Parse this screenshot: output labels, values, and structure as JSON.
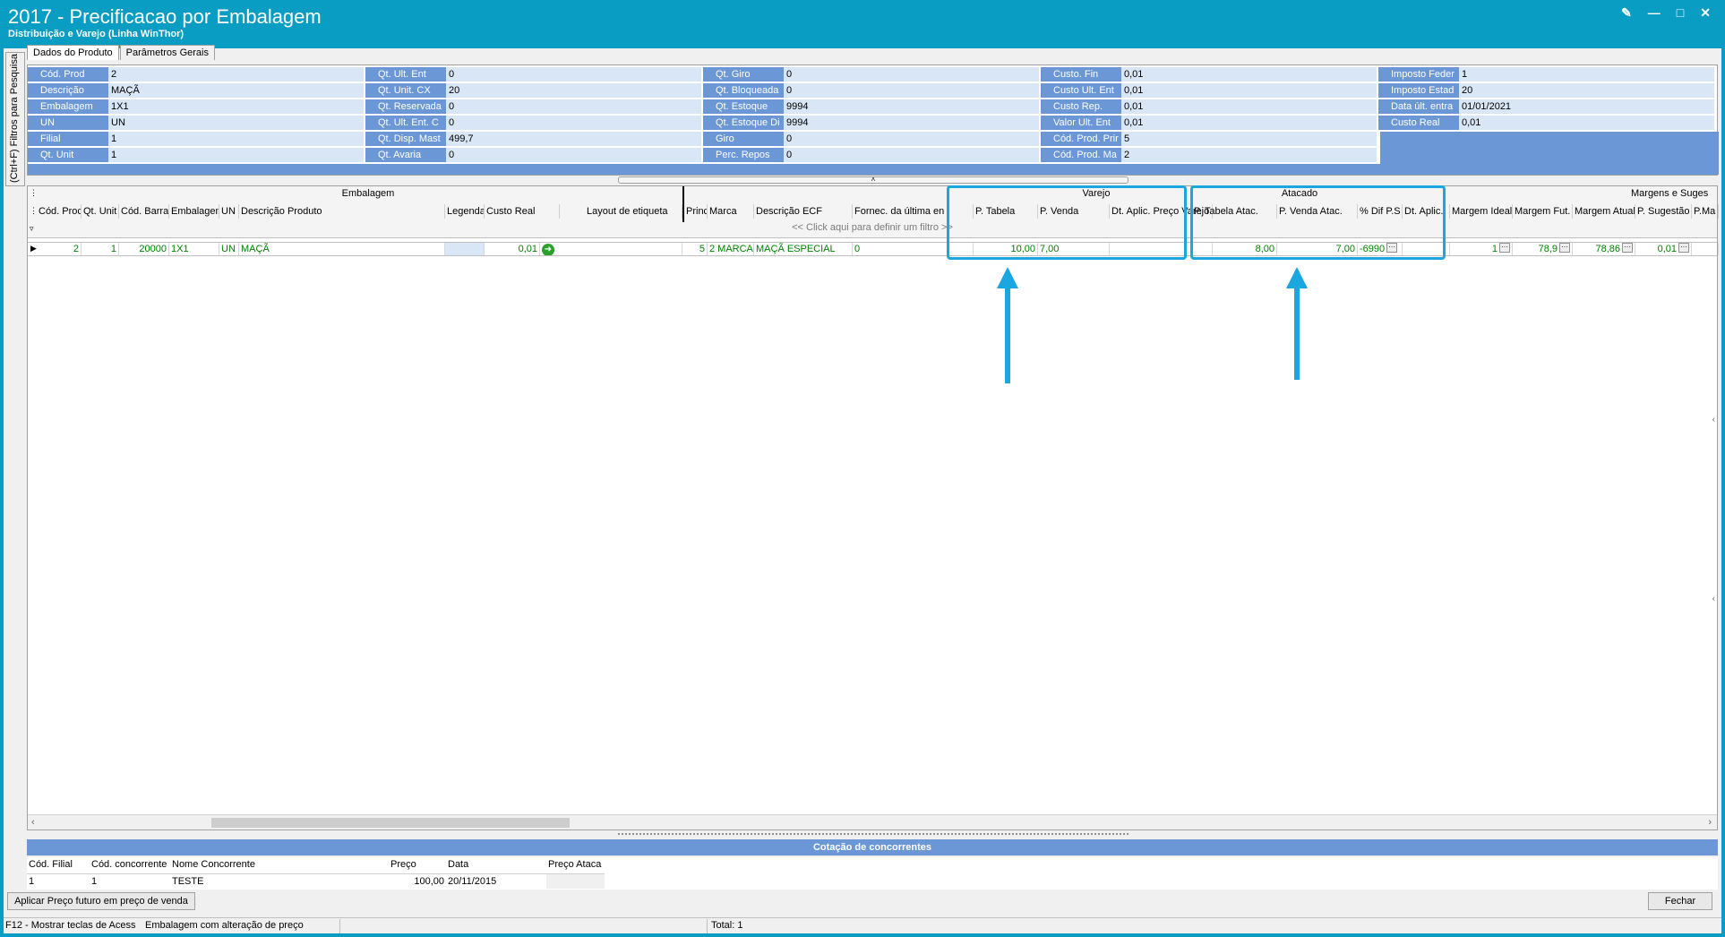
{
  "window": {
    "title": "2017 - Precificacao por Embalagem",
    "subtitle": "Distribuição e Varejo (Linha WinThor)"
  },
  "side_tab": "(Ctrl+F) Filtros para Pesquisa",
  "tabs": [
    "Dados do Produto",
    "Parâmetros Gerais"
  ],
  "info": {
    "col1": [
      {
        "label": "Cód. Prod",
        "value": "2"
      },
      {
        "label": "Descrição",
        "value": "MAÇÃ"
      },
      {
        "label": "Embalagem",
        "value": "1X1"
      },
      {
        "label": "UN",
        "value": "UN"
      },
      {
        "label": "Filial",
        "value": "1"
      },
      {
        "label": "Qt. Unit",
        "value": "1"
      }
    ],
    "col2": [
      {
        "label": "Qt. Ult. Ent",
        "value": "0"
      },
      {
        "label": "Qt. Unit. CX",
        "value": "20"
      },
      {
        "label": "Qt. Reservada",
        "value": "0"
      },
      {
        "label": "Qt. Ult. Ent. C",
        "value": "0"
      },
      {
        "label": "Qt. Disp. Mast",
        "value": "499,7"
      },
      {
        "label": "Qt. Avaria",
        "value": "0"
      }
    ],
    "col3": [
      {
        "label": "Qt. Giro",
        "value": "0"
      },
      {
        "label": "Qt. Bloqueada",
        "value": "0"
      },
      {
        "label": "Qt. Estoque",
        "value": "9994"
      },
      {
        "label": "Qt. Estoque Di",
        "value": "9994"
      },
      {
        "label": "Giro",
        "value": "0"
      },
      {
        "label": "Perc. Repos",
        "value": "0"
      }
    ],
    "col4": [
      {
        "label": "Custo. Fin",
        "value": "0,01"
      },
      {
        "label": "Custo Ult. Ent",
        "value": "0,01"
      },
      {
        "label": "Custo Rep.",
        "value": "0,01"
      },
      {
        "label": "Valor Ult. Ent",
        "value": "0,01"
      },
      {
        "label": "Cód. Prod. Prir",
        "value": "5"
      },
      {
        "label": "Cód. Prod. Ma",
        "value": "2"
      }
    ],
    "col5": [
      {
        "label": "Imposto Feder",
        "value": "1"
      },
      {
        "label": "Imposto Estad",
        "value": "20"
      },
      {
        "label": "Data últ. entra",
        "value": "01/01/2021"
      },
      {
        "label": "Custo Real",
        "value": "0,01"
      }
    ]
  },
  "grid": {
    "bands": {
      "embalagem": "Embalagem",
      "varejo": "Varejo",
      "atacado": "Atacado",
      "margens": "Margens e Suges"
    },
    "columns": {
      "cod_prod": "Cód. Proc",
      "qt_unit": "Qt. Unit",
      "cod_barra": "Cód. Barra",
      "embalagem": "Embalagen",
      "un": "UN",
      "descricao": "Descrição Produto",
      "legenda": "Legenda",
      "custo_real": "Custo Real",
      "layout": "Layout de etiqueta",
      "princ": "Princ.",
      "marca": "Marca",
      "desc_ecf": "Descrição ECF",
      "fornec": "Fornec. da última en",
      "p_tabela": "P. Tabela",
      "p_venda": "P. Venda",
      "dt_aplic_varejo": "Dt. Aplic. Preço Varejo",
      "p_tabela_atac": "P. Tabela Atac.",
      "p_venda_atac": "P. Venda Atac.",
      "dif": "% Dif P.S",
      "dt_aplic": "Dt. Aplic.",
      "margem_ideal": "Margem Ideal",
      "margem_fut": "Margem Fut.",
      "margem_atual": "Margem Atual",
      "p_sugestao": "P. Sugestão",
      "p_ma": "P.Ma"
    },
    "filter_hint": "<< Click aqui para definir um filtro >>",
    "row": {
      "cod_prod": "2",
      "qt_unit": "1",
      "cod_barra": "20000",
      "embalagem": "1X1",
      "un": "UN",
      "descricao": "MAÇÃ",
      "custo_real": "0,01",
      "princ": "5",
      "marca": "2 MARCA",
      "desc_ecf": "MAÇÃ  ESPECIAL",
      "fornec": "0",
      "p_tabela": "10,00",
      "p_venda": "7,00",
      "p_tabela_atac": "8,00",
      "p_venda_atac": "7,00",
      "dif": "-6990",
      "margem_ideal": "1",
      "margem_fut": "78,9",
      "margem_atual": "78,86",
      "p_sugestao": "0,01"
    }
  },
  "competitors": {
    "title": "Cotação de concorrentes",
    "headers": [
      "Cód. Filial",
      "Cód. concorrente",
      "Nome Concorrente",
      "Preço",
      "Data",
      "Preço Ataca"
    ],
    "row": [
      "1",
      "1",
      "TESTE",
      "100,00",
      "20/11/2015",
      ""
    ]
  },
  "buttons": {
    "apply_future": "Aplicar Preço futuro em preço de venda",
    "close": "Fechar"
  },
  "status": {
    "hint": "F12 - Mostrar teclas de Acess",
    "message": "Embalagem com alteração de preço",
    "total": "Total: 1"
  },
  "colors": {
    "titlebar": "#0a9dc4",
    "label_bg": "#6b97d6",
    "value_bg": "#d9e6f5",
    "highlight": "#1ca6e0",
    "data_text": "#008000"
  }
}
